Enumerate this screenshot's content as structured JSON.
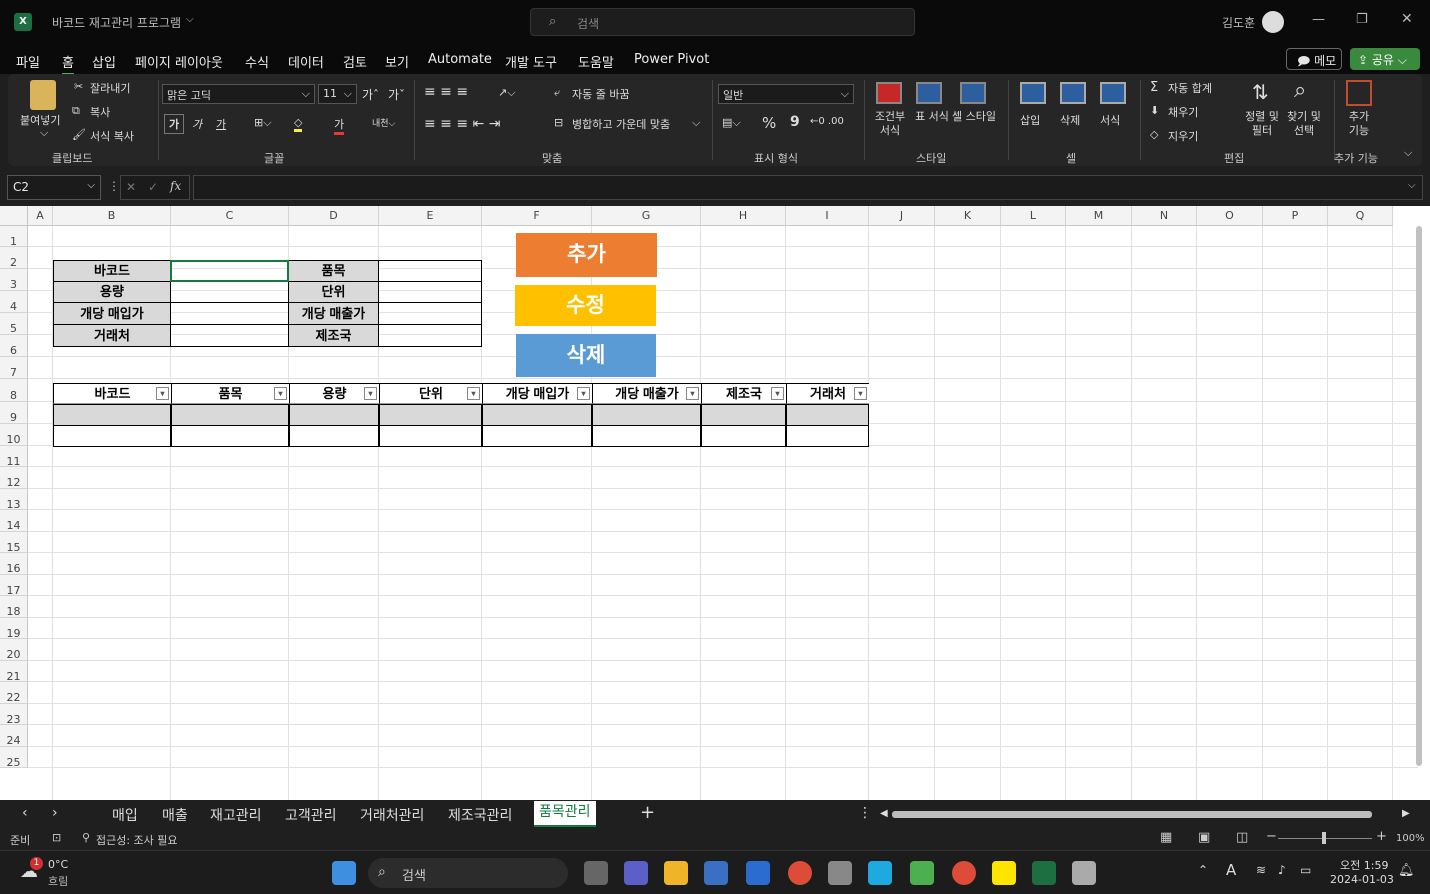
{
  "title": {
    "app_name": "바코드 재고관리 프로그램",
    "search_placeholder": "검색",
    "user": "김도훈"
  },
  "menu": [
    "파일",
    "홈",
    "삽입",
    "페이지 레이아웃",
    "수식",
    "데이터",
    "검토",
    "보기",
    "Automate",
    "개발 도구",
    "도움말",
    "Power Pivot"
  ],
  "top_buttons": {
    "memo": "메모",
    "share": "공유"
  },
  "ribbon": {
    "paste": "붙여넣기",
    "cut": "잘라내기",
    "copy": "복사",
    "format_painter": "서식 복사",
    "clipboard": "클립보드",
    "font_name": "맑은 고딕",
    "font_size": "11",
    "font": "글꼴",
    "bold": "가",
    "italic": "가",
    "underline": "가",
    "font_color": "가",
    "wrap": "자동 줄 바꿈",
    "merge": "병합하고 가운데 맞춤",
    "align": "맞춤",
    "number_format": "일반",
    "number": "표시 형식",
    "percent": "%",
    "comma": "9",
    "cond_format": "조건부 서식",
    "table_format": "표 서식",
    "cell_style": "셀 스타일",
    "styles": "스타일",
    "insert": "삽입",
    "delete": "삭제",
    "format": "서식",
    "cells": "셀",
    "autosum": "자동 합계",
    "fill": "채우기",
    "clear": "지우기",
    "sort": "정렬 및 필터",
    "find": "찾기 및 선택",
    "editing": "편집",
    "addins": "추가 기능",
    "addins_group": "추가 기능"
  },
  "namebox": "C2",
  "formula": "",
  "columns": [
    "A",
    "B",
    "C",
    "D",
    "E",
    "F",
    "G",
    "H",
    "I",
    "J",
    "K",
    "L",
    "M",
    "N",
    "O",
    "P",
    "Q"
  ],
  "rows": [
    "1",
    "2",
    "3",
    "4",
    "5",
    "6",
    "7",
    "8",
    "9",
    "10",
    "11",
    "12",
    "13",
    "14",
    "15",
    "16",
    "17",
    "18",
    "19",
    "20",
    "21",
    "22",
    "23",
    "24",
    "25"
  ],
  "form": {
    "barcode": "바코드",
    "capacity": "용량",
    "buy_price": "개당 매입가",
    "supplier": "거래처",
    "item": "품목",
    "unit": "단위",
    "sell_price": "개당 매출가",
    "maker": "제조국"
  },
  "buttons": {
    "add": "추가",
    "edit": "수정",
    "delete": "삭제",
    "colors": {
      "add": "#ED7D31",
      "edit": "#FFC000",
      "delete": "#5B9BD5"
    }
  },
  "table_headers": [
    "바코드",
    "품목",
    "용량",
    "단위",
    "개당 매입가",
    "개당 매출가",
    "제조국",
    "거래처"
  ],
  "sheets": [
    "매입",
    "매출",
    "재고관리",
    "고객관리",
    "거래처관리",
    "제조국관리",
    "품목관리"
  ],
  "active_sheet": "품목관리",
  "status": {
    "ready": "준비",
    "accessibility": "접근성: 조사 필요",
    "zoom": "100%"
  },
  "taskbar": {
    "weather_temp": "0°C",
    "weather_desc": "흐림",
    "search": "검색",
    "time": "오전 1:59",
    "date": "2024-01-03",
    "badge": "1"
  }
}
